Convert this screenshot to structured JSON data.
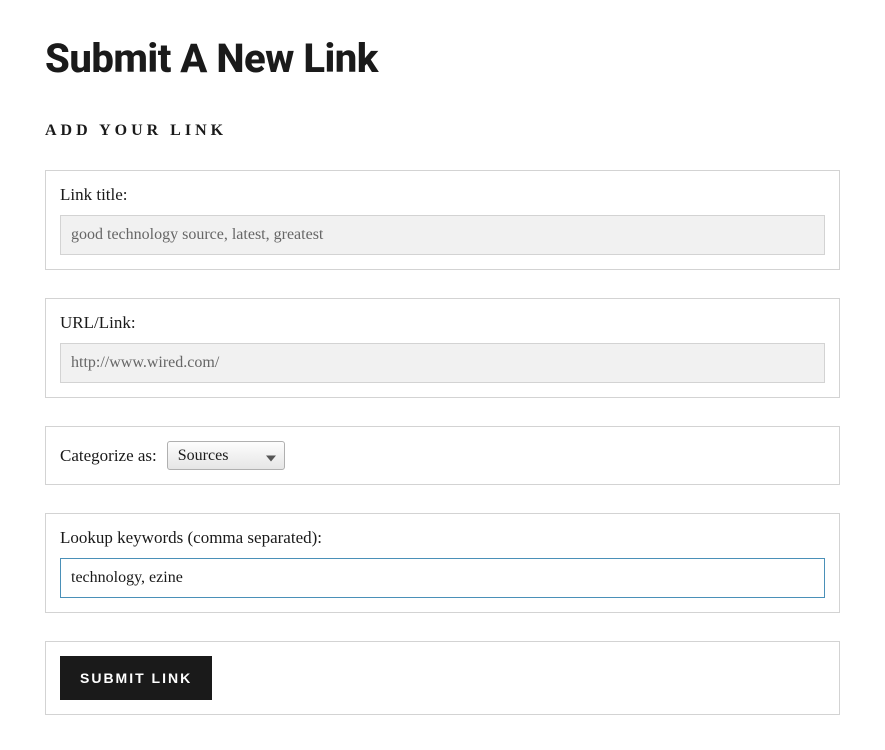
{
  "page": {
    "title": "Submit A New Link",
    "section_heading": "ADD YOUR LINK"
  },
  "form": {
    "link_title": {
      "label": "Link title:",
      "value": "good technology source, latest, greatest"
    },
    "url": {
      "label": "URL/Link:",
      "value": "http://www.wired.com/"
    },
    "category": {
      "label": "Categorize as:",
      "selected": "Sources"
    },
    "keywords": {
      "label": "Lookup keywords (comma separated):",
      "value": "technology, ezine"
    },
    "submit_label": "SUBMIT LINK"
  }
}
